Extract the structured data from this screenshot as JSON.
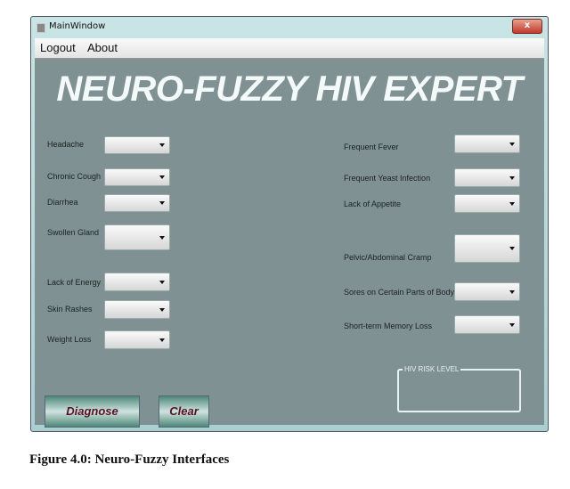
{
  "window": {
    "title": "MainWindow",
    "close_label": "x"
  },
  "menu": [
    "Logout",
    "About"
  ],
  "app_title": "NEURO-FUZZY HIV EXPERT",
  "left_fields": [
    {
      "label": "Headache",
      "value": ""
    },
    {
      "label": "Chronic Cough",
      "value": ""
    },
    {
      "label": "Diarrhea",
      "value": ""
    },
    {
      "label": "Swollen Gland",
      "value": ""
    },
    {
      "label": "Lack of Energy",
      "value": ""
    },
    {
      "label": "Skin Rashes",
      "value": ""
    },
    {
      "label": "Weight Loss",
      "value": ""
    }
  ],
  "right_fields": [
    {
      "label": "Frequent Fever",
      "value": ""
    },
    {
      "label": "Frequent Yeast Infection",
      "value": ""
    },
    {
      "label": "Lack of Appetite",
      "value": ""
    },
    {
      "label": "Pelvic/Abdominal Cramp",
      "value": ""
    },
    {
      "label": "Sores on Certain Parts of Body",
      "value": ""
    },
    {
      "label": "Short-term Memory Loss",
      "value": ""
    }
  ],
  "buttons": {
    "diagnose": "Diagnose",
    "clear": "Clear"
  },
  "risk_group": {
    "label": "HIV RISK LEVEL",
    "value": ""
  },
  "caption": "Figure 4.0: Neuro-Fuzzy Interfaces"
}
